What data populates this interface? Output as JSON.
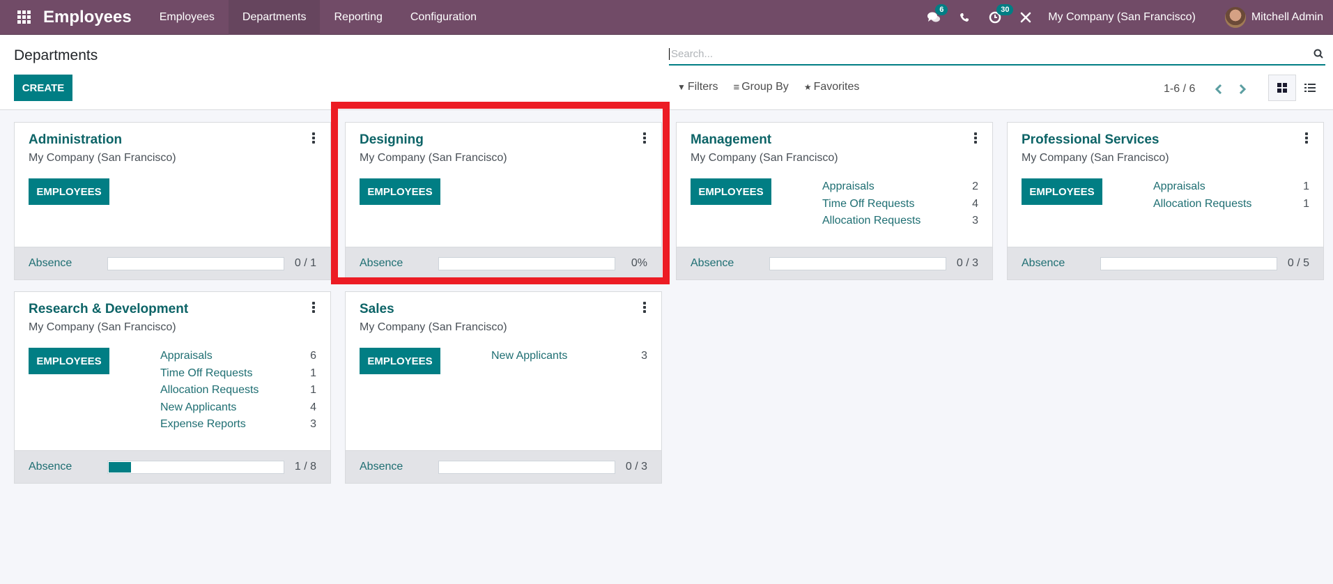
{
  "navbar": {
    "app_name": "Employees",
    "menu": [
      {
        "label": "Employees",
        "active": false
      },
      {
        "label": "Departments",
        "active": true
      },
      {
        "label": "Reporting",
        "active": false
      },
      {
        "label": "Configuration",
        "active": false
      }
    ],
    "messages_badge": "6",
    "activities_badge": "30",
    "company": "My Company (San Francisco)",
    "user": "Mitchell Admin",
    "icons": [
      "apps-grid-icon",
      "chat-icon",
      "phone-icon",
      "activity-clock-icon",
      "debug-tools-icon"
    ]
  },
  "control_panel": {
    "title": "Departments",
    "create_label": "CREATE",
    "search_placeholder": "Search...",
    "filters_label": "Filters",
    "group_by_label": "Group By",
    "favorites_label": "Favorites",
    "pager": "1-6 / 6",
    "active_view": "kanban"
  },
  "departments": [
    {
      "name": "Administration",
      "company": "My Company (San Francisco)",
      "button": "EMPLOYEES",
      "stats": [],
      "absence_label": "Absence",
      "absence_value": "0 / 1",
      "absence_fraction": 0
    },
    {
      "name": "Designing",
      "company": "My Company (San Francisco)",
      "button": "EMPLOYEES",
      "stats": [],
      "absence_label": "Absence",
      "absence_value": "0%",
      "absence_fraction": 0,
      "highlighted": true
    },
    {
      "name": "Management",
      "company": "My Company (San Francisco)",
      "button": "EMPLOYEES",
      "stats": [
        {
          "label": "Appraisals",
          "value": "2"
        },
        {
          "label": "Time Off Requests",
          "value": "4"
        },
        {
          "label": "Allocation Requests",
          "value": "3"
        }
      ],
      "absence_label": "Absence",
      "absence_value": "0 / 3",
      "absence_fraction": 0
    },
    {
      "name": "Professional Services",
      "company": "My Company (San Francisco)",
      "button": "EMPLOYEES",
      "stats": [
        {
          "label": "Appraisals",
          "value": "1"
        },
        {
          "label": "Allocation Requests",
          "value": "1"
        }
      ],
      "absence_label": "Absence",
      "absence_value": "0 / 5",
      "absence_fraction": 0
    },
    {
      "name": "Research & Development",
      "company": "My Company (San Francisco)",
      "button": "EMPLOYEES",
      "stats": [
        {
          "label": "Appraisals",
          "value": "6"
        },
        {
          "label": "Time Off Requests",
          "value": "1"
        },
        {
          "label": "Allocation Requests",
          "value": "1"
        },
        {
          "label": "New Applicants",
          "value": "4"
        },
        {
          "label": "Expense Reports",
          "value": "3"
        }
      ],
      "absence_label": "Absence",
      "absence_value": "1 / 8",
      "absence_fraction": 0.125
    },
    {
      "name": "Sales",
      "company": "My Company (San Francisco)",
      "button": "EMPLOYEES",
      "stats": [
        {
          "label": "New Applicants",
          "value": "3"
        }
      ],
      "absence_label": "Absence",
      "absence_value": "0 / 3",
      "absence_fraction": 0
    }
  ],
  "colors": {
    "navbar": "#714b67",
    "primary": "#017e84",
    "highlight": "#ec1c24"
  }
}
